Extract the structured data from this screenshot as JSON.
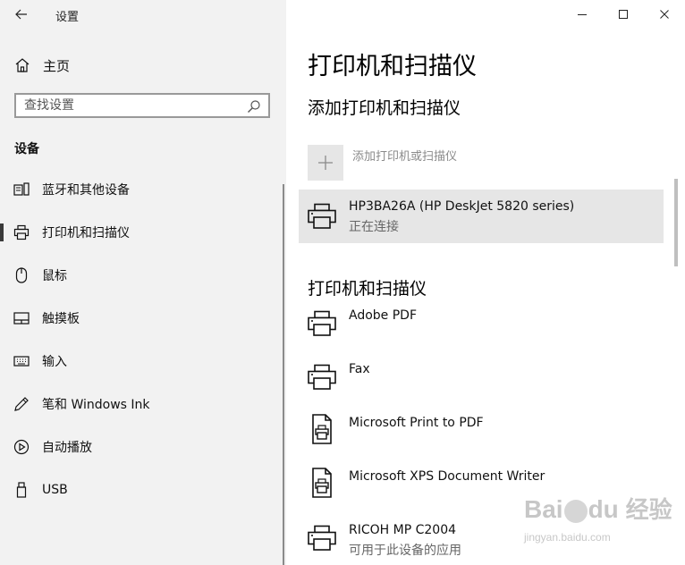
{
  "app": {
    "title": "设置"
  },
  "window": {
    "minimize_icon": "minimize-icon",
    "maximize_icon": "maximize-icon",
    "close_icon": "close-icon"
  },
  "sidebar": {
    "home_label": "主页",
    "search_placeholder": "查找设置",
    "section": "设备",
    "items": [
      {
        "label": "蓝牙和其他设备",
        "icon": "bluetooth-devices-icon"
      },
      {
        "label": "打印机和扫描仪",
        "icon": "printer-icon",
        "selected": true
      },
      {
        "label": "鼠标",
        "icon": "mouse-icon"
      },
      {
        "label": "触摸板",
        "icon": "touchpad-icon"
      },
      {
        "label": "输入",
        "icon": "keyboard-icon"
      },
      {
        "label": "笔和 Windows Ink",
        "icon": "pen-icon"
      },
      {
        "label": "自动播放",
        "icon": "autoplay-icon"
      },
      {
        "label": "USB",
        "icon": "usb-icon"
      }
    ]
  },
  "main": {
    "title": "打印机和扫描仪",
    "add_section": "添加打印机和扫描仪",
    "add_button_label": "添加打印机或扫描仪",
    "found_device": {
      "name": "HP3BA26A (HP DeskJet 5820 series)",
      "status": "正在连接"
    },
    "list_section": "打印机和扫描仪",
    "devices": [
      {
        "name": "Adobe PDF",
        "icon": "printer-icon"
      },
      {
        "name": "Fax",
        "icon": "printer-icon"
      },
      {
        "name": "Microsoft Print to PDF",
        "icon": "pdf-printer-icon"
      },
      {
        "name": "Microsoft XPS Document Writer",
        "icon": "pdf-printer-icon"
      },
      {
        "name": "RICOH MP C2004",
        "icon": "printer-icon",
        "status": "可用于此设备的应用"
      }
    ]
  },
  "watermark": {
    "brand": "Bai",
    "brand2": "du",
    "product": "经验",
    "url": "jingyan.baidu.com"
  },
  "colors": {
    "sidebar_bg": "#f2f2f2",
    "selected_bg": "#e6e6e6",
    "text": "#111111",
    "muted": "#666666"
  }
}
